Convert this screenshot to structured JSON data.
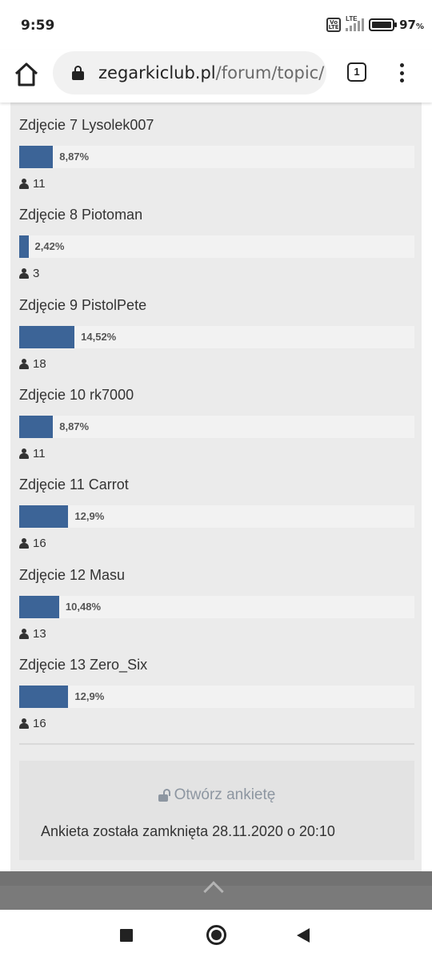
{
  "status_bar": {
    "time": "9:59",
    "network": "LTE",
    "volte": "Vo LTE",
    "battery_percent": "97",
    "battery_unit": "%"
  },
  "browser": {
    "url_domain": "zegarkiclub.pl",
    "url_path": "/forum/topic/",
    "tab_count": "1",
    "icons": [
      "home-icon",
      "lock-icon",
      "tabs-icon",
      "more-vert-icon"
    ]
  },
  "poll": {
    "choices": [
      {
        "title": "Zdjęcie 7 Lysolek007",
        "percent_label": "8,87%",
        "percent": 8.87,
        "votes": "11"
      },
      {
        "title": "Zdjęcie 8 Piotoman",
        "percent_label": "2,42%",
        "percent": 2.42,
        "votes": "3"
      },
      {
        "title": "Zdjęcie 9 PistolPete",
        "percent_label": "14,52%",
        "percent": 14.52,
        "votes": "18"
      },
      {
        "title": "Zdjęcie 10 rk7000",
        "percent_label": "8,87%",
        "percent": 8.87,
        "votes": "11"
      },
      {
        "title": "Zdjęcie 11 Carrot",
        "percent_label": "12,9%",
        "percent": 12.9,
        "votes": "16"
      },
      {
        "title": "Zdjęcie 12 Masu",
        "percent_label": "10,48%",
        "percent": 10.48,
        "votes": "13"
      },
      {
        "title": "Zdjęcie 13 Zero_Six",
        "percent_label": "12,9%",
        "percent": 12.9,
        "votes": "16"
      }
    ],
    "bar_color": "#3c6497",
    "open_poll_label": "Otwórz ankietę",
    "closed_text": "Ankieta została zamknięta 28.11.2020 o 20:10"
  },
  "nav": {
    "icons": [
      "recents-icon",
      "home-circle-icon",
      "back-triangle-icon",
      "chevron-up-icon"
    ]
  }
}
